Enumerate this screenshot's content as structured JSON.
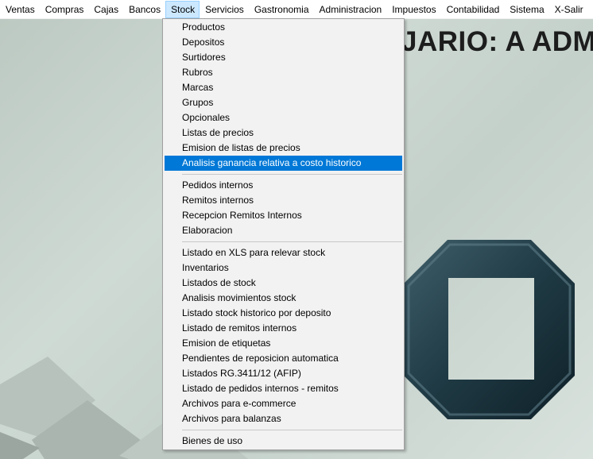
{
  "menubar": {
    "items": [
      "Ventas",
      "Compras",
      "Cajas",
      "Bancos",
      "Stock",
      "Servicios",
      "Gastronomia",
      "Administracion",
      "Impuestos",
      "Contabilidad",
      "Sistema",
      "X-Salir"
    ],
    "active": "Stock"
  },
  "desktop": {
    "banner": "JARIO: A ADM"
  },
  "stock_menu": {
    "group1": [
      "Productos",
      "Depositos",
      "Surtidores",
      "Rubros",
      "Marcas",
      "Grupos",
      "Opcionales",
      "Listas de precios",
      "Emision de listas de precios",
      "Analisis ganancia relativa a costo historico"
    ],
    "group2": [
      "Pedidos internos",
      "Remitos internos",
      "Recepcion Remitos Internos",
      "Elaboracion"
    ],
    "group3": [
      "Listado en XLS para relevar stock",
      "Inventarios",
      "Listados de stock",
      "Analisis movimientos stock",
      "Listado stock historico por  deposito",
      "Listado de remitos internos",
      "Emision de etiquetas",
      "Pendientes de reposicion automatica",
      "Listados RG.3411/12 (AFIP)",
      "Listado de pedidos internos - remitos",
      "Archivos para e-commerce",
      "Archivos para balanzas"
    ],
    "group4": [
      "Bienes de uso"
    ],
    "selected": "Analisis ganancia relativa a costo historico"
  },
  "colors": {
    "selection": "#0078d7",
    "menu_active_bg": "#cce8ff",
    "logo": "#1f3a44"
  }
}
